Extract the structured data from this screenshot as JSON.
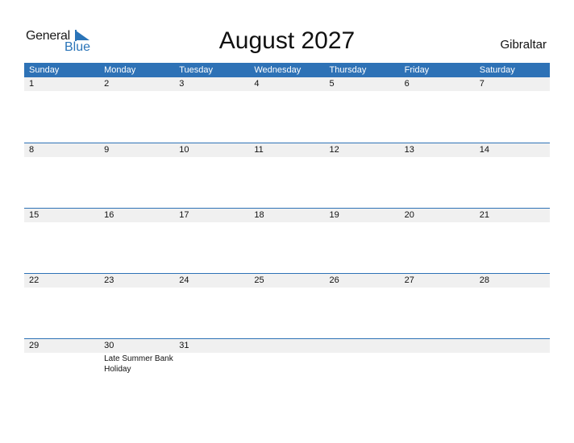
{
  "logo": {
    "general": "General",
    "blue": "Blue"
  },
  "title": "August 2027",
  "region": "Gibraltar",
  "colors": {
    "accent": "#2e72b6",
    "row_bg": "#f0f0f0"
  },
  "weekdays": [
    "Sunday",
    "Monday",
    "Tuesday",
    "Wednesday",
    "Thursday",
    "Friday",
    "Saturday"
  ],
  "weeks": [
    [
      {
        "d": "1"
      },
      {
        "d": "2"
      },
      {
        "d": "3"
      },
      {
        "d": "4"
      },
      {
        "d": "5"
      },
      {
        "d": "6"
      },
      {
        "d": "7"
      }
    ],
    [
      {
        "d": "8"
      },
      {
        "d": "9"
      },
      {
        "d": "10"
      },
      {
        "d": "11"
      },
      {
        "d": "12"
      },
      {
        "d": "13"
      },
      {
        "d": "14"
      }
    ],
    [
      {
        "d": "15"
      },
      {
        "d": "16"
      },
      {
        "d": "17"
      },
      {
        "d": "18"
      },
      {
        "d": "19"
      },
      {
        "d": "20"
      },
      {
        "d": "21"
      }
    ],
    [
      {
        "d": "22"
      },
      {
        "d": "23"
      },
      {
        "d": "24"
      },
      {
        "d": "25"
      },
      {
        "d": "26"
      },
      {
        "d": "27"
      },
      {
        "d": "28"
      }
    ],
    [
      {
        "d": "29"
      },
      {
        "d": "30",
        "e": "Late Summer Bank Holiday"
      },
      {
        "d": "31"
      },
      {
        "d": ""
      },
      {
        "d": ""
      },
      {
        "d": ""
      },
      {
        "d": ""
      }
    ]
  ]
}
